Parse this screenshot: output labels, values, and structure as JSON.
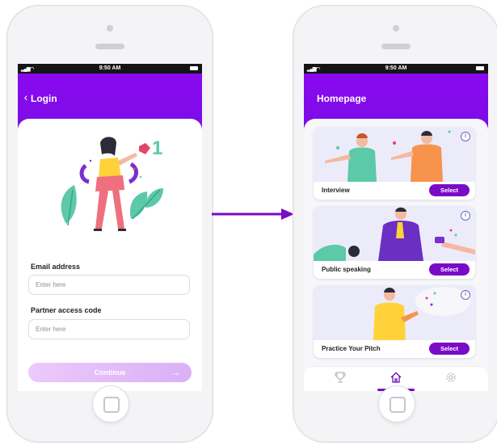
{
  "login": {
    "status_time": "9:50 AM",
    "title": "Login",
    "email_label": "Email address",
    "email_placeholder": "Enter here",
    "partner_label": "Partner access code",
    "partner_placeholder": "Enter here",
    "continue_label": "Continue",
    "badge_number": "1"
  },
  "home": {
    "status_time": "9:50 AM",
    "title": "Homepage",
    "cards": [
      {
        "name": "Interview",
        "select": "Select"
      },
      {
        "name": "Public speaking",
        "select": "Select"
      },
      {
        "name": "Practice Your Pitch",
        "select": "Select"
      }
    ],
    "info_glyph": "i",
    "tabs": [
      "trophy-icon",
      "home-icon",
      "settings-icon"
    ],
    "active_tab": "home-icon"
  },
  "colors": {
    "brand_purple": "#7c0de6",
    "button_purple": "#7a0ac8",
    "continue_disabled": "#dab0f6",
    "arrow_purple": "#7a0ac8"
  }
}
